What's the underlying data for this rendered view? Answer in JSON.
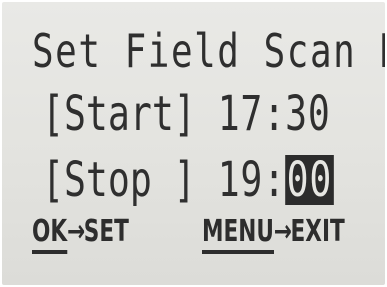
{
  "screen": {
    "title": "Set Field Scan B",
    "start": {
      "label": "[Start]",
      "hours": "17",
      "separator": ":",
      "minutes": "30"
    },
    "stop": {
      "label": "[Stop ]",
      "hours": "19",
      "separator": ":",
      "minutes": "00"
    },
    "footer": {
      "ok_key": "OK",
      "ok_arrow": "→",
      "ok_action": "SET",
      "menu_key": "MENU",
      "menu_arrow": "→",
      "menu_action": "EXIT"
    }
  },
  "colors": {
    "lcd_background": "#e6e6e2",
    "lcd_text": "#2f2f2f",
    "highlight_background": "#2c2c2c"
  }
}
